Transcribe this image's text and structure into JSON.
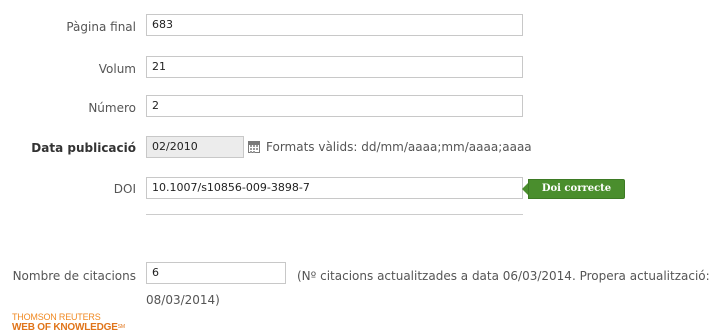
{
  "form": {
    "pagina_final": {
      "label": "Pàgina final",
      "value": "683"
    },
    "volum": {
      "label": "Volum",
      "value": "21"
    },
    "numero": {
      "label": "Número",
      "value": "2"
    },
    "data_publicacio": {
      "label": "Data publicació",
      "value": "02/2010",
      "help": "Formats vàlids: dd/mm/aaaa;mm/aaaa;aaaa"
    },
    "doi": {
      "label": "DOI",
      "value": "10.1007/s10856-009-3898-7",
      "status": "Doi correcte"
    },
    "citacions": {
      "label": "Nombre de citacions",
      "value": "6",
      "note_line1": "(Nº citacions actualitzades a data 06/03/2014. Propera actualització:",
      "note_line2": "08/03/2014)"
    }
  },
  "logo": {
    "line1": "THOMSON REUTERS",
    "line2": "WEB OF KNOWLEDGE",
    "mark": "SM"
  },
  "colors": {
    "badge_green": "#4a8e2d",
    "logo_orange": "#e0741a",
    "input_border": "#c8c8c8"
  },
  "icons": {
    "calendar": "calendar-icon"
  }
}
